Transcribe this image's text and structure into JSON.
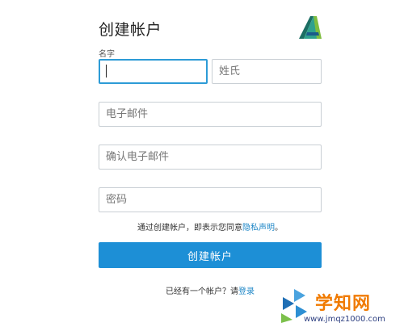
{
  "form": {
    "title": "创建帐户",
    "name_caption": "名字",
    "first_name": {
      "value": "",
      "placeholder": ""
    },
    "last_name": {
      "value": "",
      "placeholder": "姓氏"
    },
    "email": {
      "value": "",
      "placeholder": "电子邮件"
    },
    "email_confirm": {
      "value": "",
      "placeholder": "确认电子邮件"
    },
    "password": {
      "value": "",
      "placeholder": "密码"
    },
    "terms_prefix": "通过创建帐户，即表示您同意",
    "terms_link": "隐私声明",
    "terms_suffix": "。",
    "submit_label": "创建帐户",
    "signin_prefix": "已经有一个帐户？请",
    "signin_link": "登录"
  },
  "watermark": {
    "name": "学知网",
    "url": "www.jmqz1000.com"
  },
  "colors": {
    "accent": "#1d8fd6",
    "focus_border": "#2d9bd6",
    "link": "#1f87c7",
    "watermark_orange": "#f07a00"
  },
  "icons": {
    "brand_logo": "autodesk-logo",
    "watermark_logo": "watermark-logo"
  }
}
